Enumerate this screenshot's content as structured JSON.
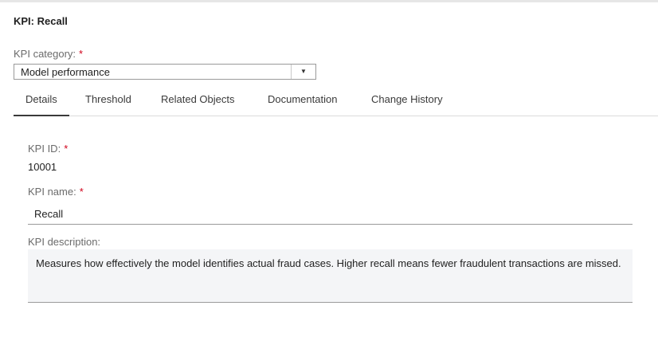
{
  "page": {
    "title": "KPI: Recall"
  },
  "category": {
    "label": "KPI category:",
    "required_mark": "*",
    "selected": "Model performance",
    "arrow_icon": "▼"
  },
  "tabs": [
    {
      "label": "Details",
      "active": true
    },
    {
      "label": "Threshold",
      "active": false
    },
    {
      "label": "Related Objects",
      "active": false
    },
    {
      "label": "Documentation",
      "active": false
    },
    {
      "label": "Change History",
      "active": false
    }
  ],
  "details": {
    "kpi_id": {
      "label": "KPI ID:",
      "required_mark": "*",
      "value": "10001"
    },
    "kpi_name": {
      "label": "KPI name:",
      "required_mark": "*",
      "value": "Recall"
    },
    "kpi_description": {
      "label": "KPI description:",
      "value": "Measures how effectively the model identifies actual fraud cases. Higher recall means fewer fraudulent transactions are missed."
    }
  },
  "colors": {
    "required": "#d0021b",
    "label": "#6b6b6b",
    "text": "#1f1f1f",
    "textarea_bg": "#f4f5f7"
  }
}
